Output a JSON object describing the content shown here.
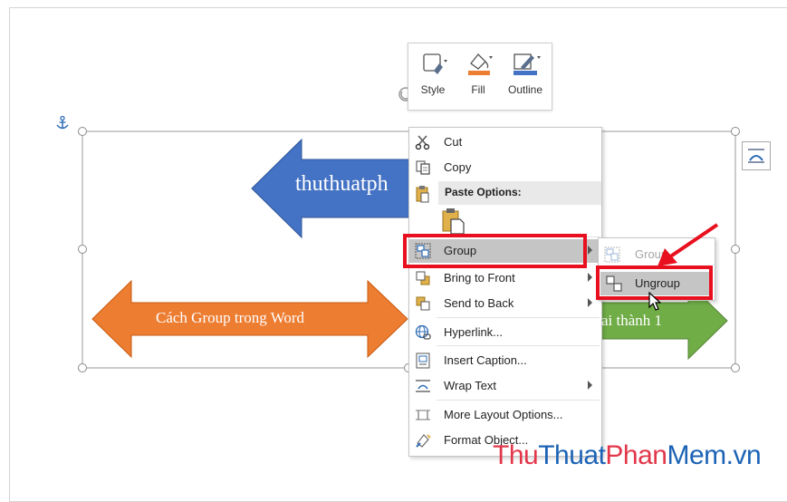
{
  "shapes": {
    "blue_arrow_text": "thuthuatph",
    "orange_arrow_text": "Cách Group trong Word",
    "green_arrow_text": "ai thành 1"
  },
  "mini_toolbar": {
    "style_label": "Style",
    "fill_label": "Fill",
    "outline_label": "Outline"
  },
  "context_menu": {
    "cut": "Cut",
    "copy": "Copy",
    "paste_options": "Paste Options:",
    "group": "Group",
    "bring_to_front": "Bring to Front",
    "send_to_back": "Send to Back",
    "hyperlink": "Hyperlink...",
    "insert_caption": "Insert Caption...",
    "wrap_text": "Wrap Text",
    "more_layout": "More Layout Options...",
    "format_object": "Format Object..."
  },
  "submenu": {
    "group": "Group",
    "ungroup": "Ungroup"
  },
  "watermark": {
    "part1": "Thu",
    "part2": "Thuat",
    "part3": "Phan",
    "part4": "Mem.vn"
  },
  "colors": {
    "blue_arrow": "#4472c4",
    "orange_arrow": "#ed7d31",
    "green_arrow": "#70ad47",
    "highlight_red": "#e8101e",
    "menu_hover": "#c5c5c5"
  }
}
